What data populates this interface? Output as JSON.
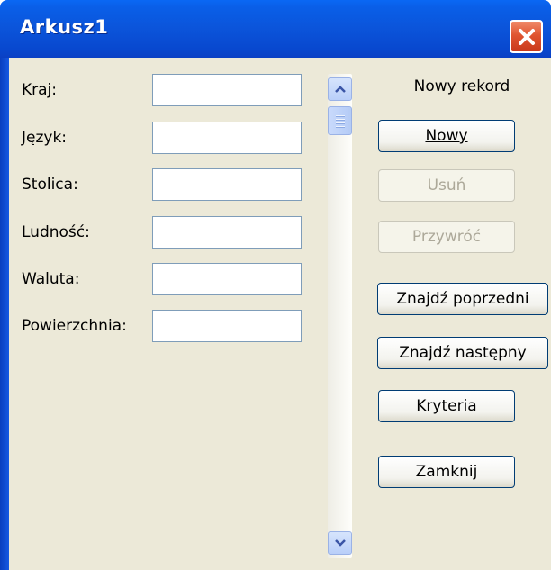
{
  "window": {
    "title": "Arkusz1"
  },
  "fields": [
    {
      "label": "Kraj:",
      "value": ""
    },
    {
      "label": "Język:",
      "value": ""
    },
    {
      "label": "Stolica:",
      "value": ""
    },
    {
      "label": "Ludność:",
      "value": ""
    },
    {
      "label": "Waluta:",
      "value": ""
    },
    {
      "label": "Powierzchnia:",
      "value": ""
    }
  ],
  "record_status": "Nowy rekord",
  "buttons": {
    "new": "Nowy",
    "delete": "Usuń",
    "restore": "Przywróć",
    "find_prev": "Znajdź poprzedni",
    "find_next": "Znajdź następny",
    "criteria": "Kryteria",
    "close": "Zamknij"
  },
  "icons": {
    "close": "close-x-icon",
    "scroll_up": "chevron-up-icon",
    "scroll_down": "chevron-down-icon",
    "thumb": "scroll-thumb-grip-icon"
  },
  "colors": {
    "titlebar": "#0b54da",
    "close_button": "#e05530",
    "dialog_bg": "#ece9d8",
    "field_border": "#7f9db9",
    "button_border": "#003c74",
    "disabled_text": "#aca899"
  }
}
